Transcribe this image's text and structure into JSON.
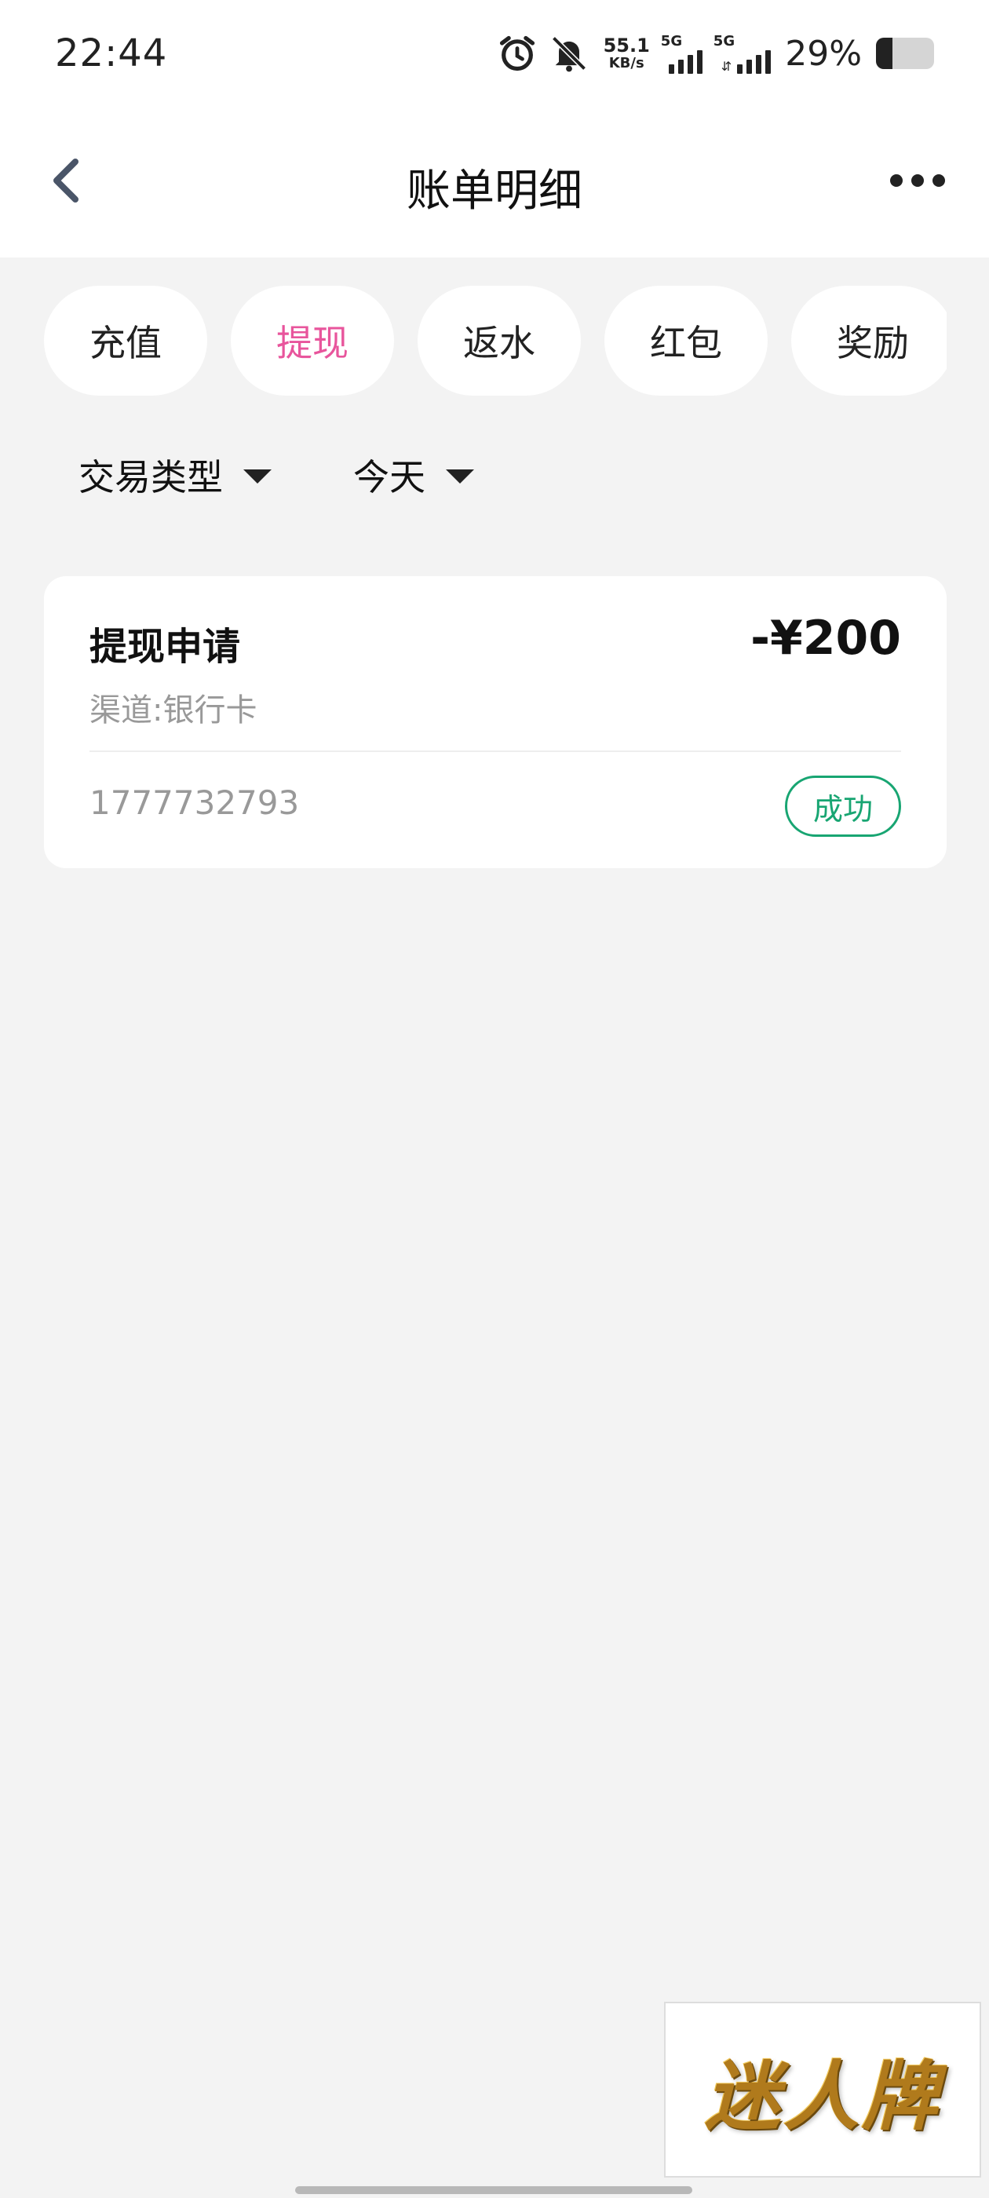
{
  "status_bar": {
    "time": "22:44",
    "net_speed_value": "55.1",
    "net_speed_unit": "KB/s",
    "sim1_label": "5G",
    "sim2_label": "5G",
    "battery_text": "29%",
    "battery_level": 0.29,
    "icons": [
      "alarm-icon",
      "bell-muted-icon",
      "signal-icon",
      "signal-icon",
      "battery-icon"
    ]
  },
  "header": {
    "title": "账单明细",
    "back_icon": "chevron-left-icon",
    "more_icon": "more-horizontal-icon"
  },
  "tabs": [
    {
      "label": "充值",
      "active": false
    },
    {
      "label": "提现",
      "active": true
    },
    {
      "label": "返水",
      "active": false
    },
    {
      "label": "红包",
      "active": false
    },
    {
      "label": "奖励",
      "active": false
    }
  ],
  "filters": {
    "type_label": "交易类型",
    "date_label": "今天"
  },
  "records": [
    {
      "title": "提现申请",
      "amount": "-¥200",
      "channel": "渠道:银行卡",
      "order_no": "1777732793",
      "status": "成功"
    }
  ],
  "watermark": {
    "text": "迷人牌"
  },
  "colors": {
    "accent_active_tab": "#e8559c",
    "success": "#18a572",
    "page_bg": "#f3f3f3"
  }
}
